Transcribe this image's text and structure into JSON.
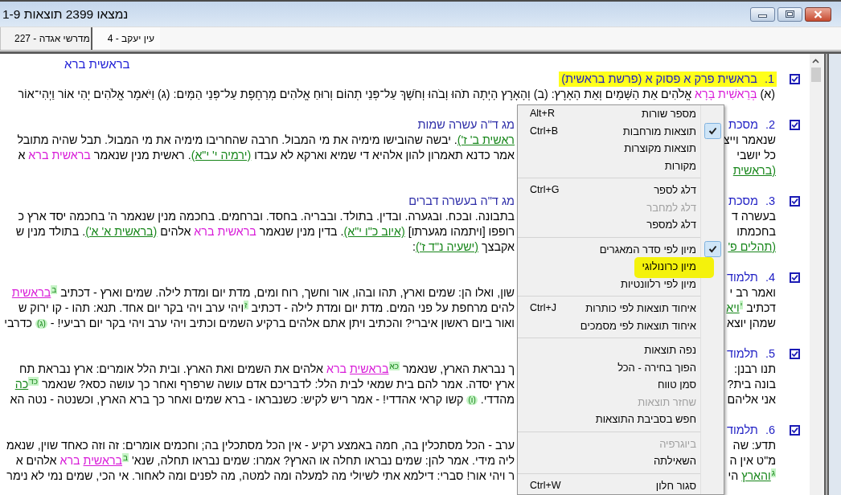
{
  "window": {
    "title": "נמצאו 2399 תוצאות 1-9"
  },
  "tabs": [
    {
      "label": "עין יעקב - 4",
      "selected": true
    },
    {
      "label": "מדרשי אגדה - 227",
      "selected": false
    }
  ],
  "query": "בראשית ברא",
  "results": [
    {
      "number": "1.",
      "title": "בראשית פרק א פסוק א (פרשת בראשית)",
      "highlighted": true,
      "checked": true,
      "lines": [
        {
          "kind": "full",
          "segments": [
            {
              "kind": "text",
              "text": "(א) "
            },
            {
              "kind": "term",
              "text": "בְּרֵאשִׁית בָּרָא"
            },
            {
              "kind": "text",
              "text": " אֱלֹהִים אֵת הַשָּׁמַיִם וְאֵת הָאָרֶץ: (ב) וְהָאָרֶץ הָיְתָה תֹהוּ וָבֹהוּ וְחֹשֶׁךְ עַל־פְּנֵי תְהוֹם וְרוּחַ אֱלֹהִים מְרַחֶפֶת עַל־פְּנֵי הַמָּיִם:  (ג) וַיֹּאמֶר אֱלֹהִים יְהִי אוֹר וַיְהִי־אוֹר"
            }
          ]
        }
      ]
    },
    {
      "number": "2.",
      "title": "מסכת",
      "title_end": "מג ד\"ה עשרה שמות",
      "highlighted": false,
      "checked": true,
      "lines": [
        {
          "kind": "split",
          "start": [
            {
              "kind": "text",
              "text": "שנאמר וייצ"
            }
          ],
          "end": [
            {
              "kind": "ref",
              "text": "ראשית ב' ז')"
            },
            {
              "kind": "text",
              "text": ". יבשה שהובישו מימיה את מי המבול. חרבה שהחריבו מימיה את מי המבול. תבל שהיה מתובל"
            }
          ]
        },
        {
          "kind": "split",
          "start": [
            {
              "kind": "text",
              "text": "כל יושבי"
            }
          ],
          "end": [
            {
              "kind": "text",
              "text": "אמר כדנא תאמרון להון אלהיא די שמיא וארקא לא עבדו "
            },
            {
              "kind": "ref",
              "text": "(ירמיה י' י\"א)"
            },
            {
              "kind": "text",
              "text": ". ראשית מנין שנאמר "
            },
            {
              "kind": "term",
              "text": "בראשית ברא"
            },
            {
              "kind": "text",
              "text": " א"
            }
          ]
        },
        {
          "kind": "split",
          "start": [
            {
              "kind": "ref",
              "text": "(בראשית"
            }
          ]
        }
      ]
    },
    {
      "number": "3.",
      "title": "מסכת",
      "title_end": "מג ד\"ה בעשרה דברים",
      "highlighted": false,
      "checked": true,
      "lines": [
        {
          "kind": "split",
          "start": [
            {
              "kind": "text",
              "text": "בעשרה ד"
            }
          ],
          "end": [
            {
              "kind": "text",
              "text": "בתבונה. ובכח. ובגערה. ובדין. בתולד. ובבריה. בחסד. וברחמים. בחכמה מנין שנאמר ה' בחכמה יסד ארץ כ"
            }
          ]
        },
        {
          "kind": "split",
          "start": [
            {
              "kind": "text",
              "text": "בחכמתו"
            }
          ],
          "end": [
            {
              "kind": "text",
              "text": "רופפו [ויתמהו מגערתו] "
            },
            {
              "kind": "ref",
              "text": "(איוב כ\"ו י\"א)"
            },
            {
              "kind": "text",
              "text": ". בדין מנין שנאמר "
            },
            {
              "kind": "term",
              "text": "בראשית ברא"
            },
            {
              "kind": "text",
              "text": " אלהים "
            },
            {
              "kind": "ref",
              "text": "(בראשית א' א')"
            },
            {
              "kind": "text",
              "text": ". בתולד מנין ש"
            }
          ]
        },
        {
          "kind": "split",
          "start": [
            {
              "kind": "ref",
              "text": "(תהלים פ'"
            }
          ],
          "end": [
            {
              "kind": "text",
              "text": "אקבצך "
            },
            {
              "kind": "ref",
              "text": "(ישעיה נ\"ד ז')"
            },
            {
              "kind": "text",
              "text": ":"
            }
          ]
        }
      ]
    },
    {
      "number": "4.",
      "title": "תלמוד",
      "highlighted": false,
      "checked": true,
      "lines": [
        {
          "kind": "split",
          "start": [
            {
              "kind": "text",
              "text": "ואמר רב י"
            }
          ],
          "end": [
            {
              "kind": "text",
              "text": "שון, ואלו הן: שמים וארץ, תהו ובהו, אור וחשך, רוח ומים, מדת יום ומדת לילה. שמים וארץ - דכתיב "
            },
            {
              "kind": "note",
              "text": "ב"
            },
            {
              "kind": "term_link",
              "text": "בראשית"
            }
          ]
        },
        {
          "kind": "split",
          "start": [
            {
              "kind": "text",
              "text": "דכתיב "
            },
            {
              "kind": "note",
              "text": "י"
            },
            {
              "kind": "ref",
              "text": "ויא"
            }
          ],
          "end": [
            {
              "kind": "text",
              "text": "להים מרחפת על פני המים. מדת יום ומדת לילה - דכתיב "
            },
            {
              "kind": "note",
              "text": "ז"
            },
            {
              "kind": "text",
              "text": "ויהי ערב ויהי בקר יום אחד. תנא: תהו - קו ירוק ש"
            }
          ]
        },
        {
          "kind": "split",
          "start": [
            {
              "kind": "text",
              "text": "שמהן יוצא"
            }
          ],
          "end": [
            {
              "kind": "text",
              "text": "ואור ביום ראשון איברי? והכתיב ויתן אתם אלהים ברקיע השמים וכתיב ויהי ערב ויהי בקר יום רביעי! - "
            },
            {
              "kind": "note_inline",
              "text": "(ג)"
            },
            {
              "kind": "text",
              "text": " כדרבי"
            }
          ]
        }
      ]
    },
    {
      "number": "5.",
      "title": "תלמוד",
      "highlighted": false,
      "checked": true,
      "lines": [
        {
          "kind": "split",
          "start": [
            {
              "kind": "text",
              "text": "תנו רבנן:"
            }
          ],
          "end": [
            {
              "kind": "text",
              "text": "ך נבראת הארץ, שנאמר "
            },
            {
              "kind": "note",
              "text": "כא"
            },
            {
              "kind": "term_link",
              "text": "בראשית"
            },
            {
              "kind": "term",
              "text": " ברא"
            },
            {
              "kind": "text",
              "text": " אלהים את השמים ואת הארץ. ובית הלל אומרים: ארץ נבראת תח"
            }
          ]
        },
        {
          "kind": "split",
          "start": [
            {
              "kind": "text",
              "text": "בונה בית?"
            }
          ],
          "end": [
            {
              "kind": "text",
              "text": "ארץ יסדה. אמר להם בית שמאי לבית הלל: לדבריכם אדם עושה שרפרף ואחר כך עושה כסא? שנאמר "
            },
            {
              "kind": "note",
              "text": "כד"
            },
            {
              "kind": "ref",
              "text": "כה"
            }
          ]
        },
        {
          "kind": "split",
          "start": [
            {
              "kind": "text",
              "text": "אני אליהם"
            }
          ],
          "end": [
            {
              "kind": "text",
              "text": "מהדדי. "
            },
            {
              "kind": "note_inline",
              "text": "(ו)"
            },
            {
              "kind": "text",
              "text": " קשו קראי אהדדי! - אמר ריש לקיש: כשנבראו - ברא שמים ואחר כך ברא הארץ, וכשנטה - נטה הא"
            }
          ]
        }
      ]
    },
    {
      "number": "6.",
      "title": "תלמוד",
      "highlighted": false,
      "checked": true,
      "lines": [
        {
          "kind": "split",
          "start": [
            {
              "kind": "text",
              "text": "תדע: שה"
            }
          ],
          "end": [
            {
              "kind": "text",
              "text": "ערב - הכל מסתכלין בה, חמה באמצע רקיע - אין הכל מסתכלין בה; וחכמים אומרים: זה וזה כאחד שוין, שנאמ"
            }
          ]
        },
        {
          "kind": "split",
          "start": [
            {
              "kind": "text",
              "text": "מ\"ט אין ה"
            }
          ],
          "end": [
            {
              "kind": "text",
              "text": "ליה מידי. אמר להן: שמים נבראו תחלה או הארץ? אמרו: שמים נבראו תחלה, שנא' "
            },
            {
              "kind": "note",
              "text": "ב"
            },
            {
              "kind": "term_link",
              "text": "בראשית"
            },
            {
              "kind": "term",
              "text": " ברא"
            },
            {
              "kind": "text",
              "text": " אלהים א"
            }
          ]
        },
        {
          "kind": "split",
          "start": [
            {
              "kind": "note",
              "text": "ג"
            },
            {
              "kind": "ref",
              "text": "והארץ"
            },
            {
              "kind": "text",
              "text": " הי"
            }
          ],
          "end": [
            {
              "kind": "text",
              "text": "ר ויהי אור! סברי: דילמא אתי לשיולי מה למעלה ומה למטה, מה לפנים ומה לאחור. אי הכי, שמים נמי לא נימר"
            }
          ]
        }
      ]
    }
  ],
  "context_menu": {
    "items": [
      {
        "kind": "item",
        "label": "מספר שורות",
        "shortcut": "Alt+R",
        "checked": false,
        "disabled": false,
        "highlighted": false
      },
      {
        "kind": "item",
        "label": "תוצאות מורחבות",
        "shortcut": "Ctrl+B",
        "checked": true,
        "disabled": false,
        "highlighted": false
      },
      {
        "kind": "item",
        "label": "תוצאות מקוצרות",
        "checked": false,
        "disabled": false,
        "highlighted": false
      },
      {
        "kind": "item",
        "label": "מקורות",
        "checked": false,
        "disabled": false,
        "highlighted": false
      },
      {
        "kind": "separator"
      },
      {
        "kind": "item",
        "label": "דלג לספר",
        "shortcut": "Ctrl+G",
        "checked": false,
        "disabled": false,
        "highlighted": false
      },
      {
        "kind": "item",
        "label": "דלג למחבר",
        "checked": false,
        "disabled": true,
        "highlighted": false
      },
      {
        "kind": "item",
        "label": "דלג למספר",
        "checked": false,
        "disabled": false,
        "highlighted": false
      },
      {
        "kind": "separator"
      },
      {
        "kind": "item",
        "label": "מיון לפי סדר המאגרים",
        "checked": true,
        "disabled": false,
        "highlighted": false
      },
      {
        "kind": "item",
        "label": "מיון כרונולוגי",
        "checked": false,
        "disabled": false,
        "highlighted": true
      },
      {
        "kind": "item",
        "label": "מיון לפי רלוונטיות",
        "checked": false,
        "disabled": false,
        "highlighted": false
      },
      {
        "kind": "separator"
      },
      {
        "kind": "item",
        "label": "איחוד תוצאות לפי כותרות",
        "shortcut": "Ctrl+J",
        "checked": false,
        "disabled": false,
        "highlighted": false
      },
      {
        "kind": "item",
        "label": "איחוד תוצאות לפי מסמכים",
        "checked": false,
        "disabled": false,
        "highlighted": false
      },
      {
        "kind": "separator"
      },
      {
        "kind": "item",
        "label": "נפה תוצאות",
        "checked": false,
        "disabled": false,
        "highlighted": false
      },
      {
        "kind": "item",
        "label": "הפוך בחירה - הכל",
        "checked": false,
        "disabled": false,
        "highlighted": false
      },
      {
        "kind": "item",
        "label": "סמן טווח",
        "checked": false,
        "disabled": false,
        "highlighted": false
      },
      {
        "kind": "item",
        "label": "שחזר תוצאות",
        "checked": false,
        "disabled": true,
        "highlighted": false
      },
      {
        "kind": "item",
        "label": "חפש בסביבת התוצאות",
        "checked": false,
        "disabled": false,
        "highlighted": false
      },
      {
        "kind": "separator"
      },
      {
        "kind": "item",
        "label": "ביוגרפיה",
        "checked": false,
        "disabled": true,
        "highlighted": false
      },
      {
        "kind": "item",
        "label": "השאילתה",
        "checked": false,
        "disabled": false,
        "highlighted": false
      },
      {
        "kind": "separator"
      },
      {
        "kind": "item",
        "label": "סגור חלון",
        "shortcut": "Ctrl+W",
        "checked": false,
        "disabled": false,
        "highlighted": false
      }
    ]
  }
}
